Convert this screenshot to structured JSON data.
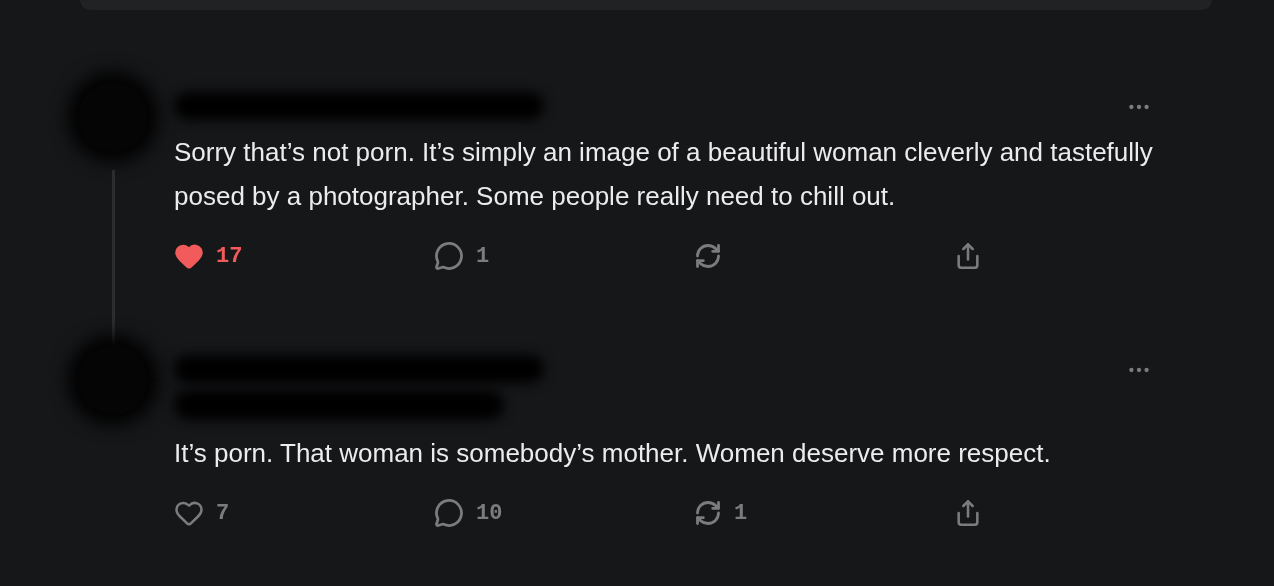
{
  "comments": [
    {
      "text": "Sorry that’s not porn. It’s simply an image of a beautiful woman cleverly and tastefully posed by a photographer. Some people really need to chill out.",
      "has_subtitle": false,
      "likes": {
        "count": "17",
        "liked": true
      },
      "replies": {
        "count": "1"
      }
    },
    {
      "text": "It’s porn. That woman is somebody’s mother. Women deserve more respect.",
      "has_subtitle": true,
      "likes": {
        "count": "7",
        "liked": false
      },
      "replies": {
        "count": "10"
      },
      "restacks": {
        "count": "1"
      }
    }
  ]
}
